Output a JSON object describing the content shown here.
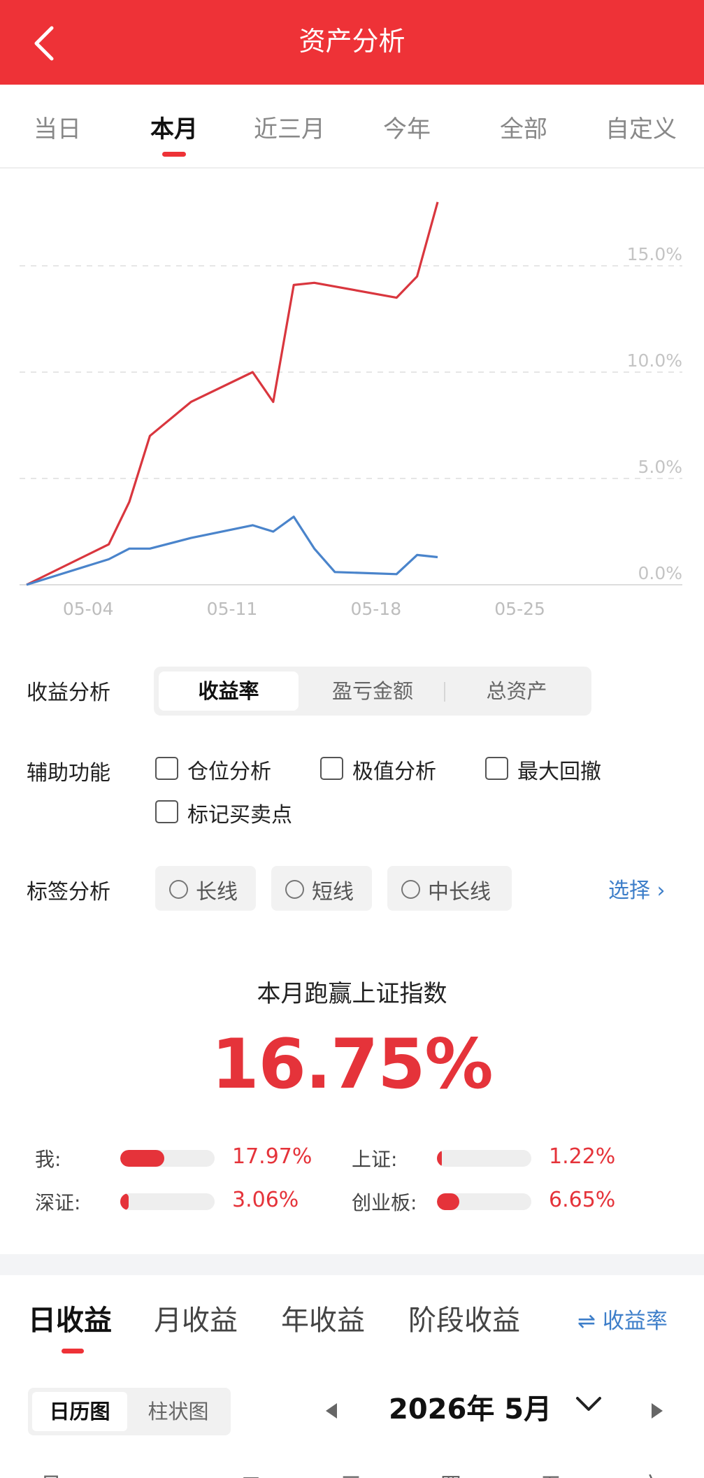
{
  "header": {
    "title": "资产分析",
    "back_icon": "chevron-left-icon"
  },
  "range_tabs": [
    {
      "label": "当日",
      "active": false
    },
    {
      "label": "本月",
      "active": true
    },
    {
      "label": "近三月",
      "active": false
    },
    {
      "label": "今年",
      "active": false
    },
    {
      "label": "全部",
      "active": false
    },
    {
      "label": "自定义",
      "active": false
    }
  ],
  "chart_data": {
    "type": "line",
    "x_tick_labels": [
      "05-04",
      "05-11",
      "05-18",
      "05-25"
    ],
    "y_tick_labels": [
      "0.0%",
      "5.0%",
      "10.0%",
      "15.0%"
    ],
    "ylim": [
      0,
      18
    ],
    "grid": true,
    "series": [
      {
        "color": "#d9363e",
        "x": [
          "05-01",
          "05-05",
          "05-06",
          "05-07",
          "05-09",
          "05-12",
          "05-13",
          "05-14",
          "05-15",
          "05-19",
          "05-20",
          "05-21"
        ],
        "values": [
          0.0,
          1.9,
          3.9,
          7.0,
          8.6,
          10.0,
          8.6,
          14.1,
          14.2,
          13.5,
          14.5,
          18.0
        ]
      },
      {
        "color": "#4a84cb",
        "x": [
          "05-01",
          "05-05",
          "05-06",
          "05-07",
          "05-09",
          "05-12",
          "05-13",
          "05-14",
          "05-15",
          "05-16",
          "05-19",
          "05-20",
          "05-21"
        ],
        "values": [
          0.0,
          1.2,
          1.7,
          1.7,
          2.2,
          2.8,
          2.5,
          3.2,
          1.7,
          0.6,
          0.5,
          1.4,
          1.3
        ]
      }
    ]
  },
  "profit_analysis": {
    "label": "收益分析",
    "options": [
      {
        "label": "收益率",
        "active": true
      },
      {
        "label": "盈亏金额",
        "active": false
      },
      {
        "label": "总资产",
        "active": false
      }
    ]
  },
  "aux": {
    "label": "辅助功能",
    "options": [
      {
        "label": "仓位分析",
        "checked": false
      },
      {
        "label": "极值分析",
        "checked": false
      },
      {
        "label": "最大回撤",
        "checked": false
      },
      {
        "label": "标记买卖点",
        "checked": false
      }
    ]
  },
  "tags": {
    "label": "标签分析",
    "options": [
      "长线",
      "短线",
      "中长线"
    ],
    "select_label": "选择 ›"
  },
  "comparison": {
    "title": "本月跑赢上证指数",
    "value": "16.75%",
    "items": [
      {
        "label": "我:",
        "value": "17.97%",
        "fraction": 0.47
      },
      {
        "label": "上证:",
        "value": "1.22%",
        "fraction": 0.05
      },
      {
        "label": "深证:",
        "value": "3.06%",
        "fraction": 0.09
      },
      {
        "label": "创业板:",
        "value": "6.65%",
        "fraction": 0.24
      }
    ]
  },
  "period_tabs": [
    {
      "label": "日收益",
      "active": true
    },
    {
      "label": "月收益",
      "active": false
    },
    {
      "label": "年收益",
      "active": false
    },
    {
      "label": "阶段收益",
      "active": false
    }
  ],
  "rate_toggle": "⇌ 收益率",
  "calendar": {
    "views": [
      {
        "label": "日历图",
        "active": true
      },
      {
        "label": "柱状图",
        "active": false
      }
    ],
    "month": "2026年 5月",
    "weekdays": [
      "日",
      "一",
      "二",
      "三",
      "四",
      "五",
      "六"
    ]
  }
}
